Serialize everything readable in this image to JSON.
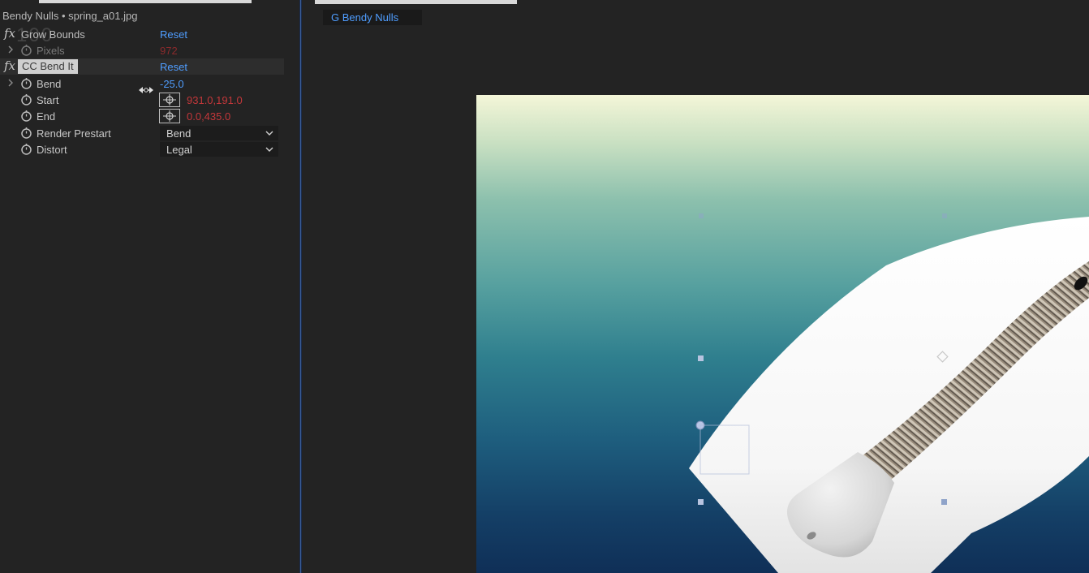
{
  "effect_controls": {
    "title": "Bendy Nulls • spring_a01.jpg",
    "zoom_ghost_text": "100",
    "effects": [
      {
        "fx": "fx",
        "name": "Grow Bounds",
        "reset": "Reset",
        "properties": [
          {
            "label": "Pixels",
            "value": "972"
          }
        ]
      },
      {
        "fx": "fx",
        "name": "CC Bend It",
        "reset": "Reset",
        "properties": [
          {
            "label": "Bend",
            "value": "-25.0"
          },
          {
            "label": "Start",
            "value": "931.0,191.0"
          },
          {
            "label": "End",
            "value": "0.0,435.0"
          },
          {
            "label": "Render Prestart",
            "value": "Bend"
          },
          {
            "label": "Distort",
            "value": "Legal"
          }
        ]
      }
    ]
  },
  "composition": {
    "tab_label": "G Bendy Nulls"
  },
  "colors": {
    "accent_blue": "#4f9dff",
    "keyframe_red": "#c4373a",
    "panel_bg": "#232323",
    "selected_label_bg": "#cfcfcf"
  },
  "icons": {
    "fx": "fx-icon",
    "twirl": "chevron-right-icon",
    "stopwatch": "stopwatch-icon",
    "crosshair": "crosshair-icon",
    "dropdown": "chevron-down-icon",
    "scrub": "scrub-arrows-icon"
  }
}
